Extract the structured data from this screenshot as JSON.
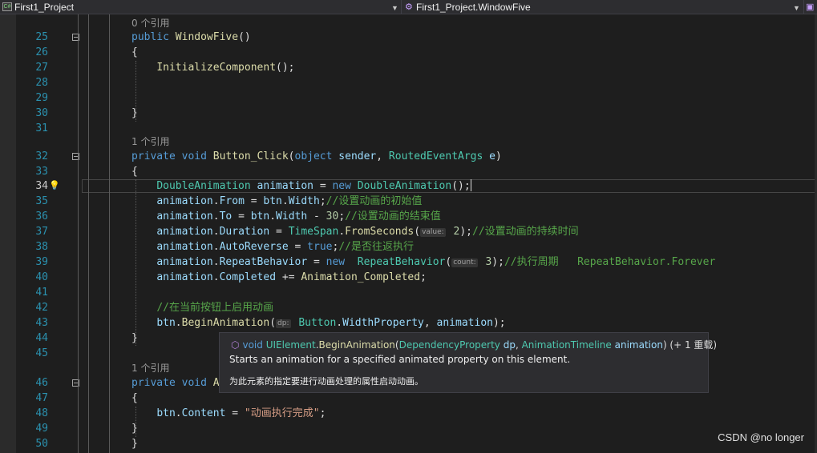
{
  "nav": {
    "project": "First1_Project",
    "member": "First1_Project.WindowFive",
    "project_icon": "csharp-project-icon",
    "member_icon": "method-icon"
  },
  "editor": {
    "current_line": "34",
    "refs": {
      "a": "0 个引用",
      "b": "1 个引用",
      "c": "1 个引用"
    },
    "lines": [
      {
        "n": "25",
        "code": [
          [
            "kw",
            "public "
          ],
          [
            "me",
            "WindowFive"
          ],
          [
            "pu",
            "()"
          ]
        ]
      },
      {
        "n": "26",
        "code": [
          [
            "pu",
            "{"
          ]
        ]
      },
      {
        "n": "27",
        "code": [
          [
            "pu",
            "    "
          ],
          [
            "me",
            "InitializeComponent"
          ],
          [
            "pu",
            "();"
          ]
        ]
      },
      {
        "n": "28",
        "code": []
      },
      {
        "n": "29",
        "code": []
      },
      {
        "n": "30",
        "code": [
          [
            "pu",
            "}"
          ]
        ]
      },
      {
        "n": "31",
        "code": []
      },
      {
        "n": "32",
        "code": [
          [
            "kw",
            "private void "
          ],
          [
            "me",
            "Button_Click"
          ],
          [
            "pu",
            "("
          ],
          [
            "kw",
            "object "
          ],
          [
            "id",
            "sender"
          ],
          [
            "pu",
            ", "
          ],
          [
            "ty",
            "RoutedEventArgs "
          ],
          [
            "id",
            "e"
          ],
          [
            "pu",
            ")"
          ]
        ]
      },
      {
        "n": "33",
        "code": [
          [
            "pu",
            "{"
          ]
        ]
      },
      {
        "n": "34",
        "code": [
          [
            "pu",
            "    "
          ],
          [
            "ty",
            "DoubleAnimation "
          ],
          [
            "id",
            "animation"
          ],
          [
            "pu",
            " = "
          ],
          [
            "kw",
            "new "
          ],
          [
            "ty",
            "DoubleAnimation"
          ],
          [
            "pu",
            "();"
          ]
        ]
      },
      {
        "n": "35",
        "code": [
          [
            "pu",
            "    "
          ],
          [
            "id",
            "animation"
          ],
          [
            "pu",
            "."
          ],
          [
            "id",
            "From"
          ],
          [
            "pu",
            " = "
          ],
          [
            "id",
            "btn"
          ],
          [
            "pu",
            "."
          ],
          [
            "id",
            "Width"
          ],
          [
            "pu",
            ";"
          ],
          [
            "cm",
            "//设置动画的初始值"
          ]
        ]
      },
      {
        "n": "36",
        "code": [
          [
            "pu",
            "    "
          ],
          [
            "id",
            "animation"
          ],
          [
            "pu",
            "."
          ],
          [
            "id",
            "To"
          ],
          [
            "pu",
            " = "
          ],
          [
            "id",
            "btn"
          ],
          [
            "pu",
            "."
          ],
          [
            "id",
            "Width"
          ],
          [
            "pu",
            " - "
          ],
          [
            "nu",
            "30"
          ],
          [
            "pu",
            ";"
          ],
          [
            "cm",
            "//设置动画的结束值"
          ]
        ]
      },
      {
        "n": "37",
        "code": [
          [
            "pu",
            "    "
          ],
          [
            "id",
            "animation"
          ],
          [
            "pu",
            "."
          ],
          [
            "id",
            "Duration"
          ],
          [
            "pu",
            " = "
          ],
          [
            "ty",
            "TimeSpan"
          ],
          [
            "pu",
            "."
          ],
          [
            "me",
            "FromSeconds"
          ],
          [
            "pu",
            "("
          ],
          [
            "hint",
            "value:"
          ],
          [
            "nu",
            " 2"
          ],
          [
            "pu",
            ");"
          ],
          [
            "cm",
            "//设置动画的持续时间"
          ]
        ]
      },
      {
        "n": "38",
        "code": [
          [
            "pu",
            "    "
          ],
          [
            "id",
            "animation"
          ],
          [
            "pu",
            "."
          ],
          [
            "id",
            "AutoReverse"
          ],
          [
            "pu",
            " = "
          ],
          [
            "kw",
            "true"
          ],
          [
            "pu",
            ";"
          ],
          [
            "cm",
            "//是否往返执行"
          ]
        ]
      },
      {
        "n": "39",
        "code": [
          [
            "pu",
            "    "
          ],
          [
            "id",
            "animation"
          ],
          [
            "pu",
            "."
          ],
          [
            "id",
            "RepeatBehavior"
          ],
          [
            "pu",
            " = "
          ],
          [
            "kw",
            "new  "
          ],
          [
            "ty",
            "RepeatBehavior"
          ],
          [
            "pu",
            "("
          ],
          [
            "hint",
            "count:"
          ],
          [
            "nu",
            " 3"
          ],
          [
            "pu",
            ");"
          ],
          [
            "cm",
            "//执行周期   RepeatBehavior.Forever"
          ]
        ]
      },
      {
        "n": "40",
        "code": [
          [
            "pu",
            "    "
          ],
          [
            "id",
            "animation"
          ],
          [
            "pu",
            "."
          ],
          [
            "id",
            "Completed"
          ],
          [
            "pu",
            " += "
          ],
          [
            "me",
            "Animation_Completed"
          ],
          [
            "pu",
            ";"
          ]
        ]
      },
      {
        "n": "41",
        "code": []
      },
      {
        "n": "42",
        "code": [
          [
            "pu",
            "    "
          ],
          [
            "cm",
            "//在当前按钮上启用动画"
          ]
        ]
      },
      {
        "n": "43",
        "code": [
          [
            "pu",
            "    "
          ],
          [
            "id",
            "btn"
          ],
          [
            "pu",
            "."
          ],
          [
            "me",
            "BeginAnimation"
          ],
          [
            "pu",
            "("
          ],
          [
            "hint",
            "dp:"
          ],
          [
            "pu",
            " "
          ],
          [
            "ty",
            "Button"
          ],
          [
            "pu",
            "."
          ],
          [
            "id",
            "WidthProperty"
          ],
          [
            "pu",
            ", "
          ],
          [
            "id",
            "animation"
          ],
          [
            "pu",
            ");"
          ]
        ]
      },
      {
        "n": "44",
        "code": [
          [
            "pu",
            "}"
          ]
        ]
      },
      {
        "n": "45",
        "code": []
      },
      {
        "n": "46",
        "code": [
          [
            "kw",
            "private void "
          ],
          [
            "me",
            "Ani"
          ]
        ]
      },
      {
        "n": "47",
        "code": [
          [
            "pu",
            "{"
          ]
        ]
      },
      {
        "n": "48",
        "code": [
          [
            "pu",
            "    "
          ],
          [
            "id",
            "btn"
          ],
          [
            "pu",
            "."
          ],
          [
            "id",
            "Content"
          ],
          [
            "pu",
            " = "
          ],
          [
            "st",
            "\"动画执行完成\""
          ],
          [
            "pu",
            ";"
          ]
        ]
      },
      {
        "n": "49",
        "code": [
          [
            "pu",
            "}"
          ]
        ]
      },
      {
        "n": "50",
        "code": [
          [
            "pu",
            "}"
          ]
        ]
      }
    ]
  },
  "tooltip": {
    "icon": "method-cube-icon",
    "signature": [
      [
        "kw",
        "void "
      ],
      [
        "ty",
        "UIElement"
      ],
      [
        "pu",
        "."
      ],
      [
        "me",
        "BeginAnimation"
      ],
      [
        "pu",
        "("
      ],
      [
        "ty",
        "DependencyProperty "
      ],
      [
        "id",
        "dp"
      ],
      [
        "pu",
        ", "
      ],
      [
        "ty",
        "AnimationTimeline "
      ],
      [
        "id",
        "animation"
      ],
      [
        "pu",
        ") (+ 1 重载)"
      ]
    ],
    "summary_en": "Starts an animation for a specified animated property on this element.",
    "summary_zh": "为此元素的指定要进行动画处理的属性启动动画。"
  },
  "watermark": "CSDN @no longer"
}
